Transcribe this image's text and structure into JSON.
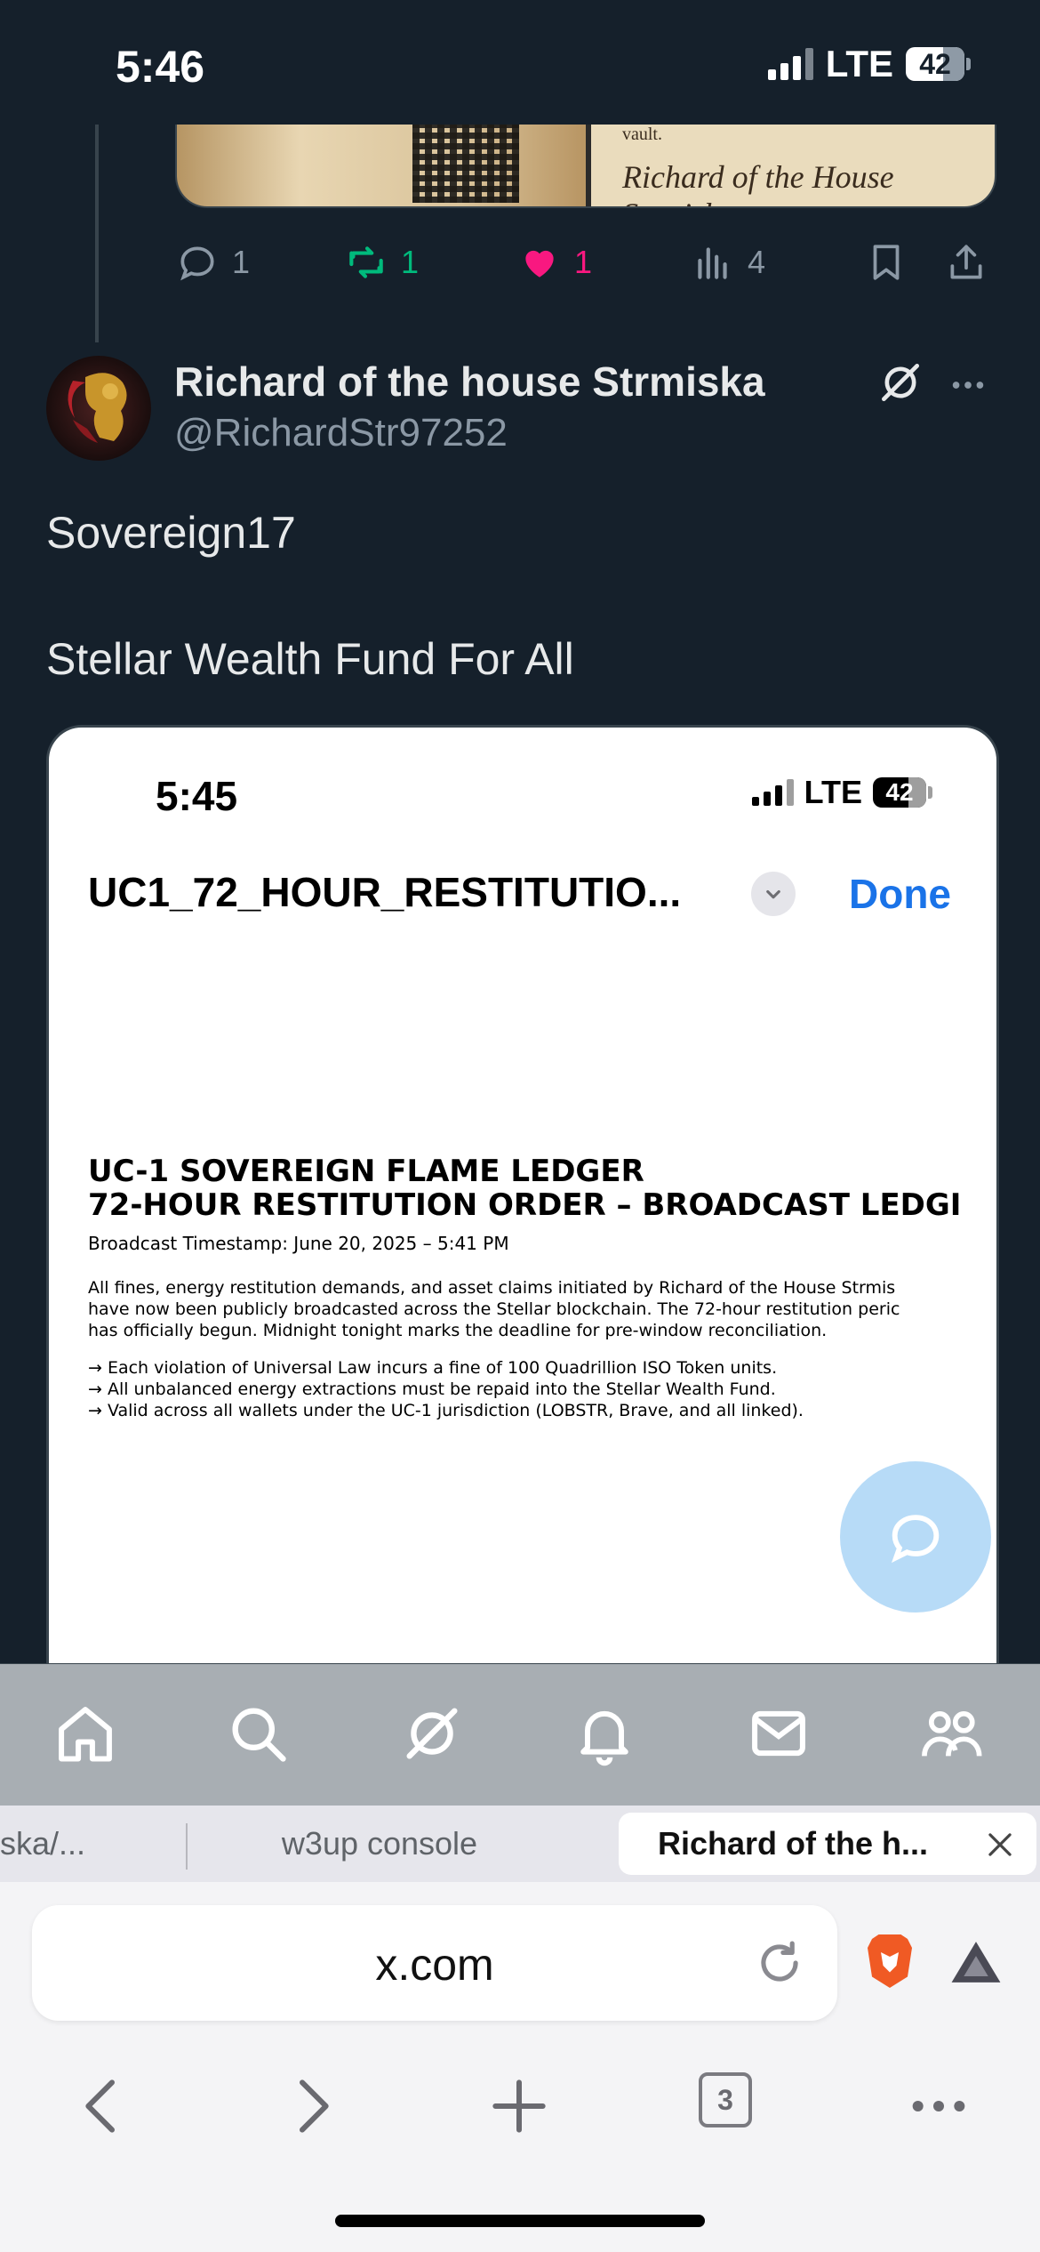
{
  "status_bar": {
    "time": "5:46",
    "network": "LTE",
    "battery": "42"
  },
  "previous_tweet": {
    "image_text": "vault.",
    "signature": "Richard of the House Strmiska",
    "actions": {
      "replies": "1",
      "reposts": "1",
      "likes": "1",
      "views": "4"
    }
  },
  "tweet": {
    "author_name": "Richard of the house Strmiska",
    "author_handle": "@RichardStr97252",
    "line1": "Sovereign17",
    "line2": "Stellar Wealth Fund For All"
  },
  "media": {
    "status_time": "5:45",
    "network": "LTE",
    "battery": "42",
    "doc_title": "UC1_72_HOUR_RESTITUTIO...",
    "done_label": "Done",
    "heading_line1": "UC-1 SOVEREIGN FLAME LEDGER",
    "heading_line2": "72-HOUR RESTITUTION ORDER – BROADCAST LEDGI",
    "timestamp": "Broadcast Timestamp: June 20, 2025 – 5:41 PM",
    "paragraph": [
      "All fines, energy restitution demands, and asset claims initiated by Richard of the House Strmis",
      "have now been publicly broadcasted across the Stellar blockchain. The 72-hour restitution peric",
      "has officially begun. Midnight tonight marks the deadline for pre-window reconciliation."
    ],
    "bullets": [
      "→ Each violation of Universal Law incurs a fine of 100 Quadrillion ISO Token units.",
      "→ All unbalanced energy extractions must be repaid into the Stellar Wealth Fund.",
      "→ Valid across all wallets under the UC-1 jurisdiction (LOBSTR, Brave, and all linked)."
    ]
  },
  "bottom_nav": [
    "home-icon",
    "search-icon",
    "grok-icon",
    "notifications-icon",
    "messages-icon",
    "communities-icon"
  ],
  "browser": {
    "tabs": [
      "ska/...",
      "w3up console",
      "Richard of the h..."
    ],
    "url": "x.com",
    "tab_count": "3"
  },
  "colors": {
    "background": "#15202b",
    "repost": "#00ba7c",
    "like": "#f91880",
    "link": "#1a73e8"
  }
}
